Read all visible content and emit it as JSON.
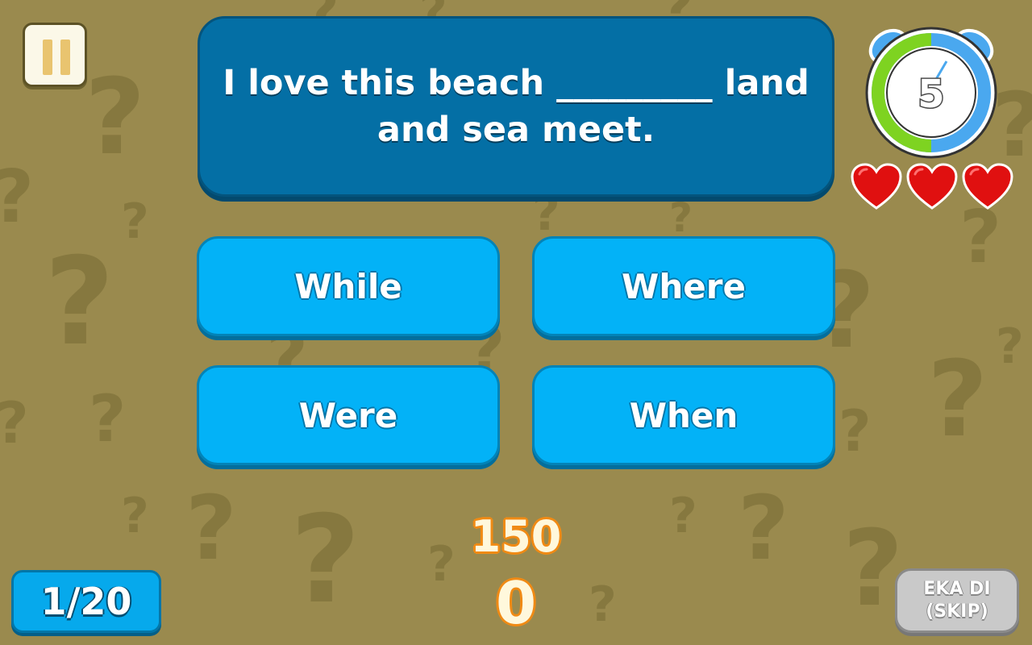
{
  "question": {
    "line1": "I love this beach _________ land",
    "line2": "and sea meet."
  },
  "timer": {
    "seconds": "5",
    "remaining_fraction": 0.5
  },
  "lives": {
    "count": 3,
    "max": 3
  },
  "answers": [
    {
      "label": "While"
    },
    {
      "label": "Where"
    },
    {
      "label": "Were"
    },
    {
      "label": "When"
    }
  ],
  "points_award": "150",
  "score": "0",
  "progress": {
    "text": "1/20",
    "current": 1,
    "total": 20
  },
  "skip": {
    "line1": "EKA DI",
    "line2": "(SKIP)"
  },
  "colors": {
    "background": "#9a8a4e",
    "question_panel": "#046fa5",
    "answer_button": "#03b2f7",
    "timer_green": "#7ed321",
    "timer_blue": "#4aa8ef",
    "heart": "#e01010",
    "score_outline": "#f08a14"
  }
}
